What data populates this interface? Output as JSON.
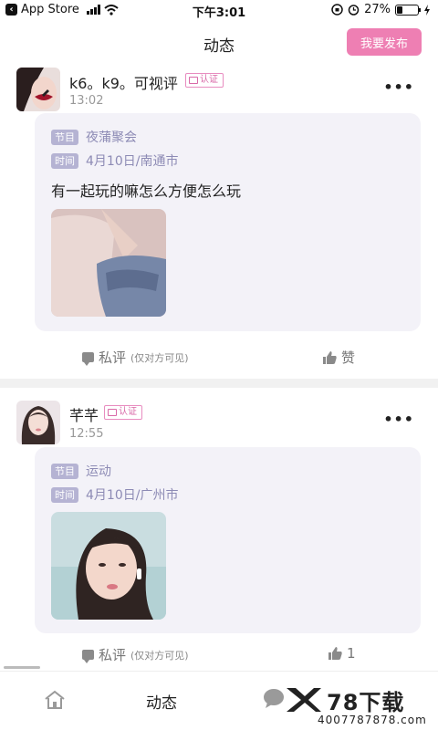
{
  "status_bar": {
    "back_app": "App Store",
    "time": "下午3:01",
    "battery": "27%",
    "battery_level": 0.27
  },
  "header": {
    "title": "动态",
    "publish_label": "我要发布"
  },
  "posts": [
    {
      "username": "k6。k9。可视评",
      "verified_label": "认证",
      "time": "13:02",
      "more": "•••",
      "tag1": "节目",
      "program": "夜蒲聚会",
      "tag2": "时间",
      "datetime_place": "4月10日/南通市",
      "text": "有一起玩的嘛怎么方便怎么玩",
      "comment_label": "私评",
      "comment_sub": "(仅对方可见)",
      "like_label": "赞"
    },
    {
      "username": "芊芊",
      "verified_label": "认证",
      "time": "12:55",
      "more": "•••",
      "tag1": "节目",
      "program": "运动",
      "tag2": "时间",
      "datetime_place": "4月10日/广州市",
      "comment_label": "私评",
      "comment_sub": "(仅对方可见)",
      "like_label": "1"
    }
  ],
  "tabbar": {
    "dynamic_label": "动态",
    "watermark_text": "78下载",
    "watermark_sub": "4007787878.com"
  },
  "colors": {
    "accent": "#ee7fb3",
    "tag_bg": "#b5b3d3",
    "card_bg": "#f3f2f8"
  }
}
